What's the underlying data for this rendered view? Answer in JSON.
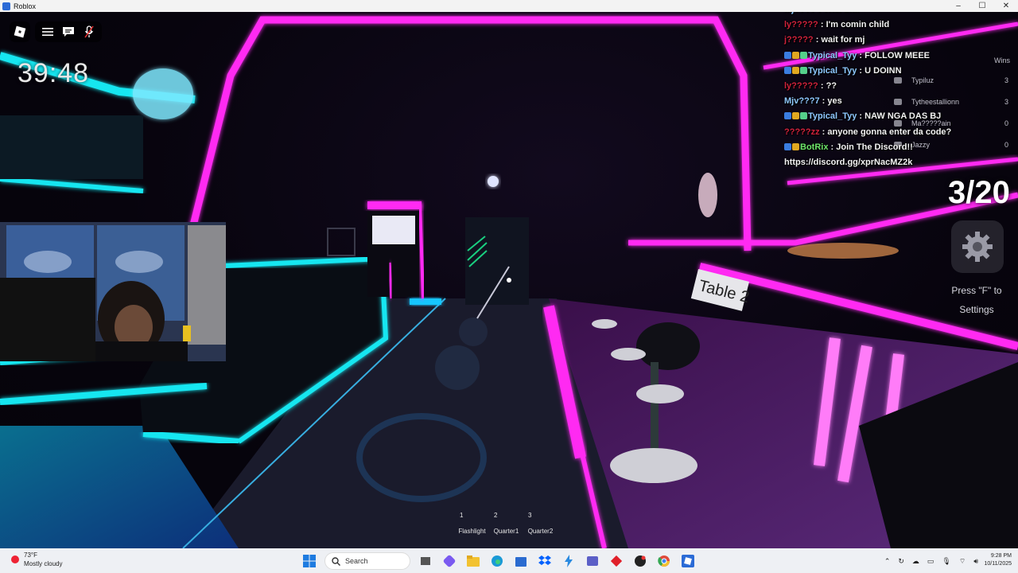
{
  "window": {
    "title": "Roblox",
    "controls": [
      "minimize-icon",
      "maximize-icon",
      "close-icon"
    ]
  },
  "hud": {
    "timer": "39:48",
    "progress": "3/20",
    "settings_hint": "Press \"F\" to Settings"
  },
  "chat": [
    {
      "name": "Mj????",
      "name_color": "#8ec8ff",
      "text": "?hci ohil",
      "badges": 0
    },
    {
      "name": "ly?????",
      "name_color": "#d0213b",
      "text": "I'm comin child",
      "badges": 0
    },
    {
      "name": "j?????",
      "name_color": "#d0213b",
      "text": "wait for mj",
      "badges": 0
    },
    {
      "name": "Typical_Tyy",
      "name_color": "#8ec8ff",
      "text": "FOLLOW MEEE",
      "badges": 3
    },
    {
      "name": "Typical_Tyy",
      "name_color": "#8ec8ff",
      "text": "U DOINN",
      "badges": 3
    },
    {
      "name": "ly?????",
      "name_color": "#d0213b",
      "text": "??",
      "badges": 0
    },
    {
      "name": "Mjv???7",
      "name_color": "#8ec8ff",
      "text": "yes",
      "badges": 0
    },
    {
      "name": "Typical_Tyy",
      "name_color": "#8ec8ff",
      "text": "NAW NGA DAS BJ",
      "badges": 3
    },
    {
      "name": "?????zz",
      "name_color": "#d0213b",
      "text": "anyone gonna enter da code?",
      "badges": 0
    },
    {
      "name": "BotRix",
      "name_color": "#6ee56a",
      "text": "Join The Discord!!",
      "badges": 2
    },
    {
      "name": "",
      "name_color": "#f2f2f2",
      "text": "https://discord.gg/xprNacMZ2k",
      "badges": 0
    }
  ],
  "leaderboard": {
    "header": "Wins",
    "rows": [
      {
        "name": "Typiluz",
        "wins": "3"
      },
      {
        "name": "Tytheestallionn",
        "wins": "3"
      },
      {
        "name": "Ma?????ain",
        "wins": "0"
      },
      {
        "name": "Jazzy",
        "wins": "0"
      }
    ]
  },
  "scene": {
    "sign_text": "Table 2"
  },
  "hotbar": [
    {
      "num": "1",
      "label": "Flashlight"
    },
    {
      "num": "2",
      "label": "Quarter1"
    },
    {
      "num": "3",
      "label": "Quarter2"
    }
  ],
  "taskbar": {
    "weather_temp": "73°F",
    "weather_desc": "Mostly cloudy",
    "search_placeholder": "Search",
    "time": "9:28 PM",
    "date": "10/11/2025"
  },
  "colors": {
    "neon_cyan": "#15e6f0",
    "neon_magenta": "#ff2bf2",
    "chat_red": "#d0213b",
    "chat_blue": "#8ec8ff",
    "chat_green": "#6ee56a"
  }
}
